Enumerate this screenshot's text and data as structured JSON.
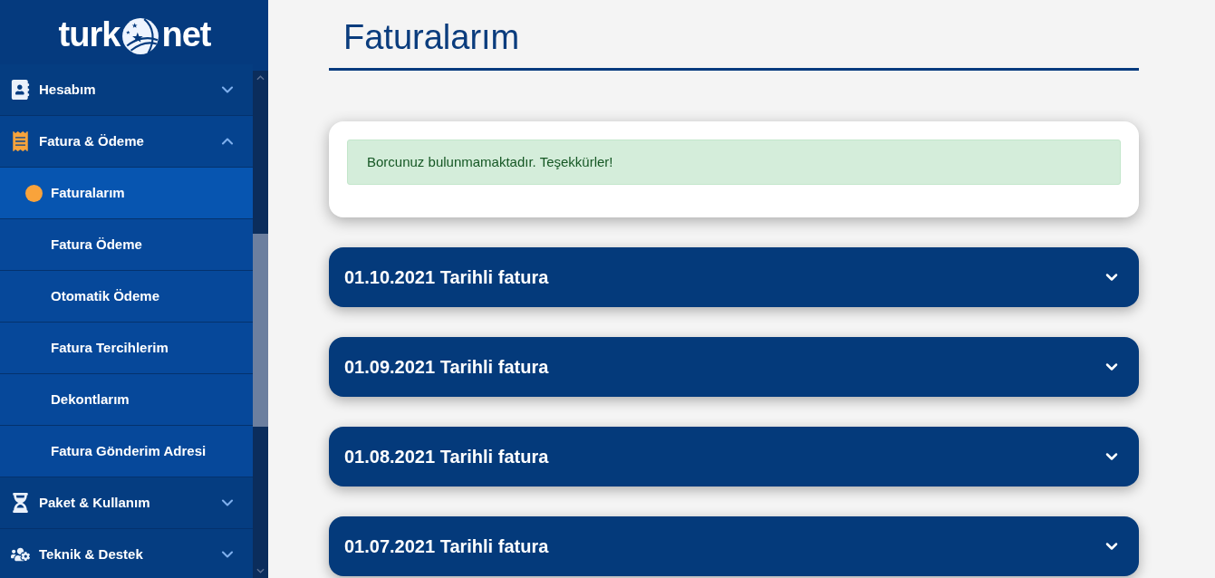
{
  "sidebar": {
    "logo": {
      "left": "turk",
      "right": "net"
    },
    "menu": [
      {
        "label": "Hesabım",
        "expanded": false
      },
      {
        "label": "Fatura & Ödeme",
        "expanded": true,
        "children": [
          {
            "label": "Faturalarım",
            "selected": true
          },
          {
            "label": "Fatura Ödeme",
            "selected": false
          },
          {
            "label": "Otomatik Ödeme",
            "selected": false
          },
          {
            "label": "Fatura Tercihlerim",
            "selected": false
          },
          {
            "label": "Dekontlarım",
            "selected": false
          },
          {
            "label": "Fatura Gönderim Adresi",
            "selected": false
          }
        ]
      },
      {
        "label": "Paket & Kullanım",
        "expanded": false
      },
      {
        "label": "Teknik & Destek",
        "expanded": false
      }
    ]
  },
  "page_title": "Faturalarım",
  "notice": "Borcunuz bulunmamaktadır. Teşekkürler!",
  "invoices": [
    {
      "title": "01.10.2021 Tarihli fatura",
      "expanded": false
    },
    {
      "title": "01.09.2021 Tarihli fatura",
      "expanded": false
    },
    {
      "title": "01.08.2021 Tarihli fatura",
      "expanded": false
    },
    {
      "title": "01.07.2021 Tarihli fatura",
      "expanded": false
    }
  ]
}
